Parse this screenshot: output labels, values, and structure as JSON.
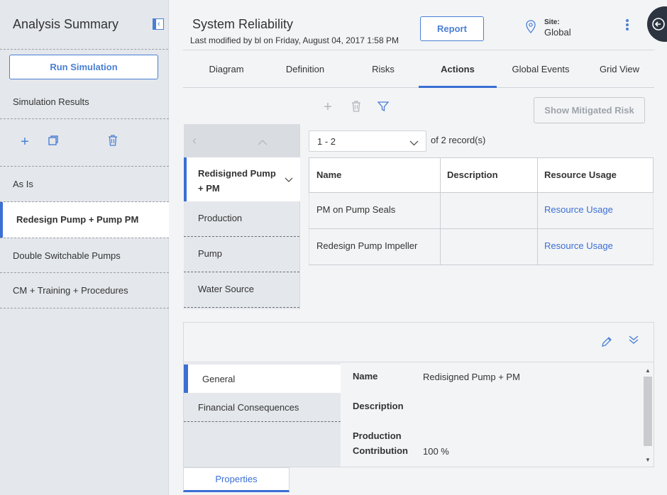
{
  "sidebar": {
    "title": "Analysis Summary",
    "run_simulation": "Run Simulation",
    "simulation_results": "Simulation Results",
    "scenarios": [
      "As Is",
      "Redesign Pump + Pump PM",
      "Double Switchable Pumps",
      "CM + Training + Procedures"
    ],
    "active_scenario": "Redesign Pump + Pump PM"
  },
  "header": {
    "title": "System Reliability",
    "subtitle": "Last modified by bl on Friday, August 04, 2017 1:58 PM",
    "report": "Report",
    "site_label": "Site:",
    "site_value": "Global"
  },
  "tabs": [
    "Diagram",
    "Definition",
    "Risks",
    "Actions",
    "Global Events",
    "Grid View"
  ],
  "active_tab": "Actions",
  "toolbar": {
    "show_mitigated_risk": "Show Mitigated Risk"
  },
  "tree": {
    "selected": "Redisigned Pump + PM",
    "items": [
      "Production",
      "Pump",
      "Water Source"
    ]
  },
  "records": {
    "range": "1 - 2",
    "of": "of",
    "total": "2",
    "suffix": "record(s)"
  },
  "table": {
    "columns": [
      "Name",
      "Description",
      "Resource Usage"
    ],
    "rows": [
      {
        "name": "PM on Pump Seals",
        "description": "",
        "resource_usage": "Resource Usage"
      },
      {
        "name": "Redesign Pump Impeller",
        "description": "",
        "resource_usage": "Resource Usage"
      }
    ]
  },
  "details": {
    "nav": [
      "General",
      "Financial Consequences"
    ],
    "active_nav": "General",
    "fields": {
      "name_label": "Name",
      "name_value": "Redisigned Pump + PM",
      "description_label": "Description",
      "description_value": "",
      "production_label_1": "Production",
      "production_label_2": "Contribution",
      "production_value": "100 %"
    }
  },
  "bottom_tab": "Properties",
  "colors": {
    "accent": "#3b6fd4",
    "sidebar_bg": "#e4e7eb",
    "page_bg": "#f3f4f6"
  }
}
